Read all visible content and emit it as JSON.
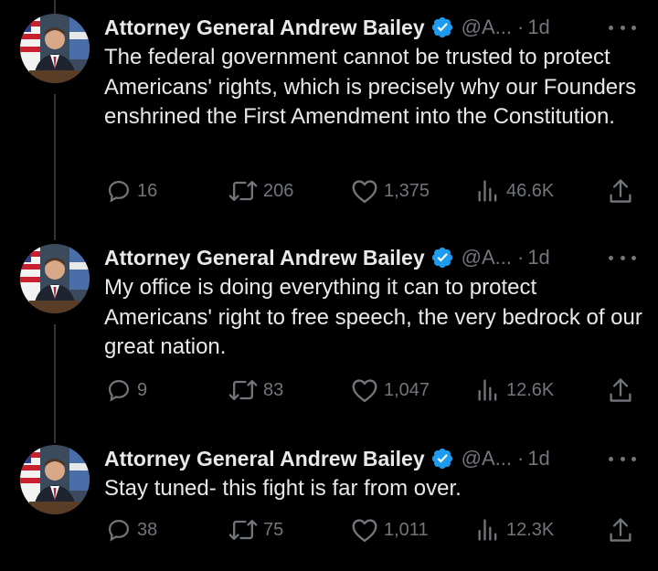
{
  "colors": {
    "background": "#000000",
    "text_primary": "#e7e9ea",
    "text_secondary": "#71767b",
    "verified_badge": "#1d9bf0",
    "thread_line": "#333639"
  },
  "tweets": [
    {
      "author_name": "Attorney General Andrew Bailey",
      "verified_icon": "verified-badge-icon",
      "handle": "@A...",
      "separator": "·",
      "time": "1d",
      "text": "The federal government cannot be trusted to protect Americans' rights, which is precisely why our Founders enshrined the First Amendment into the Constitution.",
      "replies": "16",
      "reposts": "206",
      "likes": "1,375",
      "views": "46.6K"
    },
    {
      "author_name": "Attorney General Andrew Bailey",
      "verified_icon": "verified-badge-icon",
      "handle": "@A...",
      "separator": "·",
      "time": "1d",
      "text": "My office is doing everything it can to protect Americans' right to free speech, the very bedrock of our great nation.",
      "replies": "9",
      "reposts": "83",
      "likes": "1,047",
      "views": "12.6K"
    },
    {
      "author_name": "Attorney General Andrew Bailey",
      "verified_icon": "verified-badge-icon",
      "handle": "@A...",
      "separator": "·",
      "time": "1d",
      "text": "Stay tuned- this fight is far from over.",
      "replies": "38",
      "reposts": "75",
      "likes": "1,011",
      "views": "12.3K"
    }
  ]
}
